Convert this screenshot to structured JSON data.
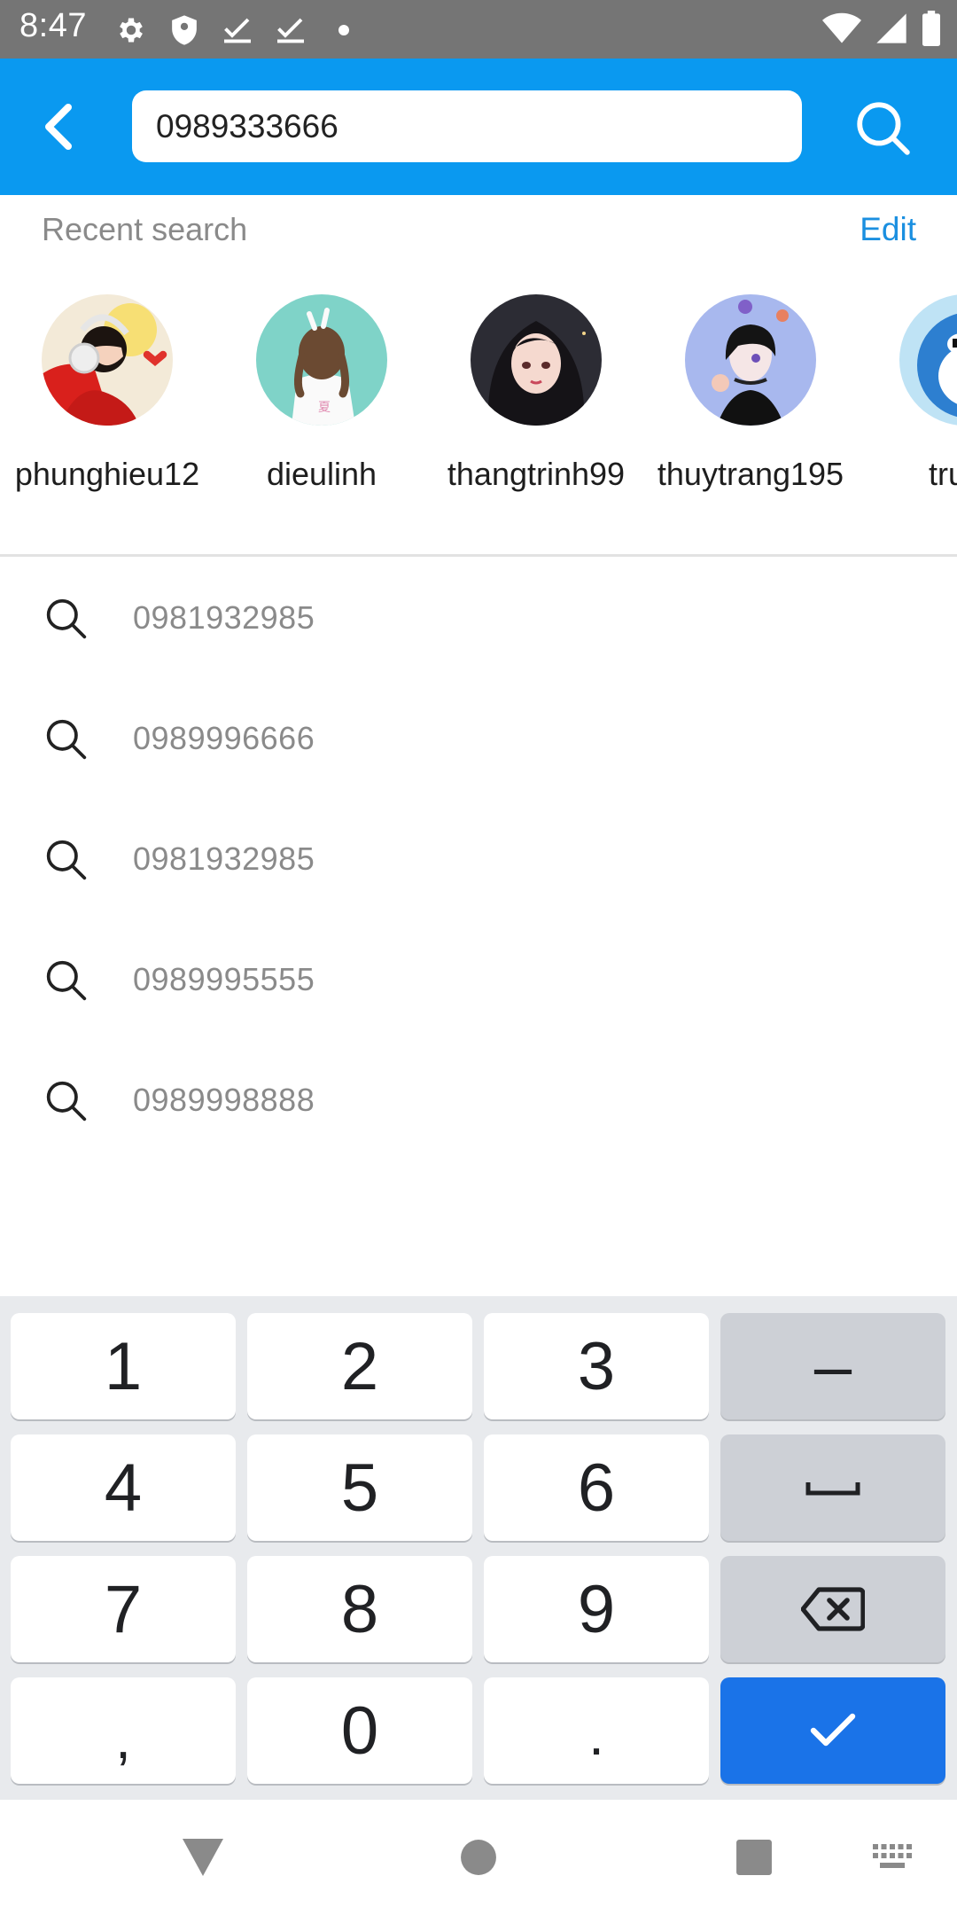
{
  "status_bar": {
    "time": "8:47",
    "icons_left": [
      "gear-icon",
      "shield-icon",
      "check-icon",
      "check-icon",
      "dot-icon"
    ],
    "icons_right": [
      "wifi-icon",
      "signal-icon",
      "battery-icon"
    ]
  },
  "app_bar": {
    "background": "#0a99f0",
    "search_value": "0989333666",
    "back_icon": "back-chevron-icon",
    "search_icon": "search-icon"
  },
  "recent": {
    "title": "Recent search",
    "edit_label": "Edit",
    "users": [
      {
        "name": "phunghieu12",
        "avatar": "avatar-red-headphones"
      },
      {
        "name": "dieulinh",
        "avatar": "avatar-girl-teal"
      },
      {
        "name": "thangtrinh99",
        "avatar": "avatar-girl-dark"
      },
      {
        "name": "thuytrang195",
        "avatar": "avatar-girl-blue"
      },
      {
        "name": "truon",
        "avatar": "avatar-blue-cartoon"
      }
    ]
  },
  "history": [
    {
      "query": "0981932985"
    },
    {
      "query": "0989996666"
    },
    {
      "query": "0981932985"
    },
    {
      "query": "0989995555"
    },
    {
      "query": "0989998888"
    }
  ],
  "keyboard": {
    "keys": [
      "1",
      "2",
      "3",
      "–",
      "4",
      "5",
      "6",
      "space",
      "7",
      "8",
      "9",
      "backspace",
      ",",
      "0",
      ".",
      "done"
    ],
    "accent": "#1a73e8"
  },
  "nav_bar": {
    "icons": [
      "back-triangle-icon",
      "home-circle-icon",
      "recents-square-icon",
      "keyboard-icon"
    ]
  }
}
